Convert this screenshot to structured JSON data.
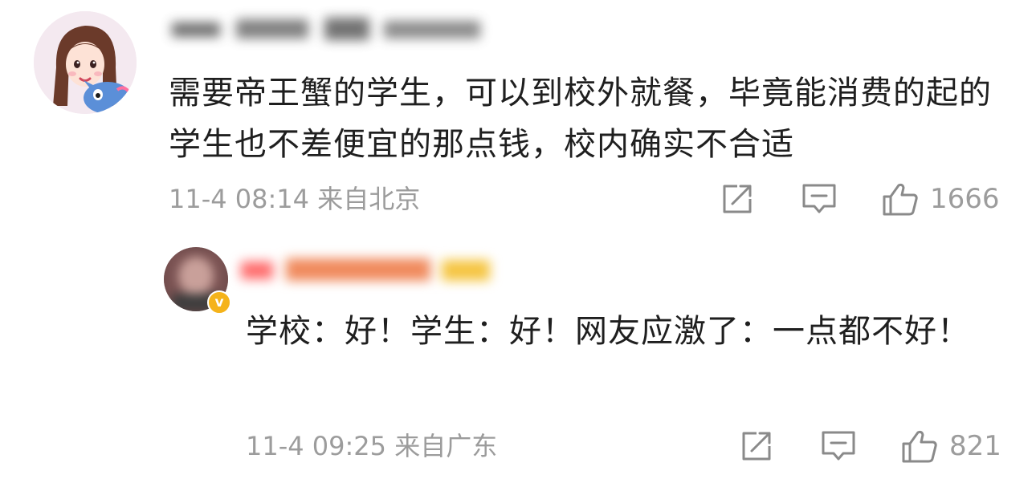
{
  "comments": [
    {
      "username": "",
      "text": "需要帝王蟹的学生，可以到校外就餐，毕竟能消费的起的学生也不差便宜的那点钱，校内确实不合适",
      "timestamp": "11-4 08:14 来自北京",
      "likes": "1666"
    },
    {
      "username": "",
      "verified_icon": "verified-badge-icon",
      "text": "学校：好！学生：好！网友应激了：一点都不好！",
      "timestamp": "11-4 09:25 来自广东",
      "likes": "821"
    }
  ],
  "icons": {
    "share": "share-icon",
    "comment": "comment-icon",
    "like": "thumbs-up-icon"
  },
  "colors": {
    "text": "#1f1f1f",
    "meta": "#9c9c9c",
    "verified": "#f5b31a"
  }
}
